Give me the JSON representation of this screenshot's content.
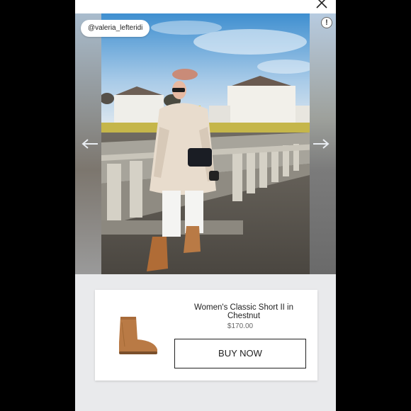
{
  "photo": {
    "handle": "@valeria_lefteridi",
    "info_glyph": "!",
    "prev_icon": "arrow-left-icon",
    "next_icon": "arrow-right-icon"
  },
  "header": {
    "close_icon": "close-icon"
  },
  "product": {
    "name": "Women's Classic Short II in Chestnut",
    "price": "$170.00",
    "buy_label": "BUY NOW",
    "image": "chestnut-boot"
  },
  "colors": {
    "background": "#000000",
    "panel": "#e9eaec",
    "card": "#ffffff",
    "boot": "#b97a45"
  }
}
